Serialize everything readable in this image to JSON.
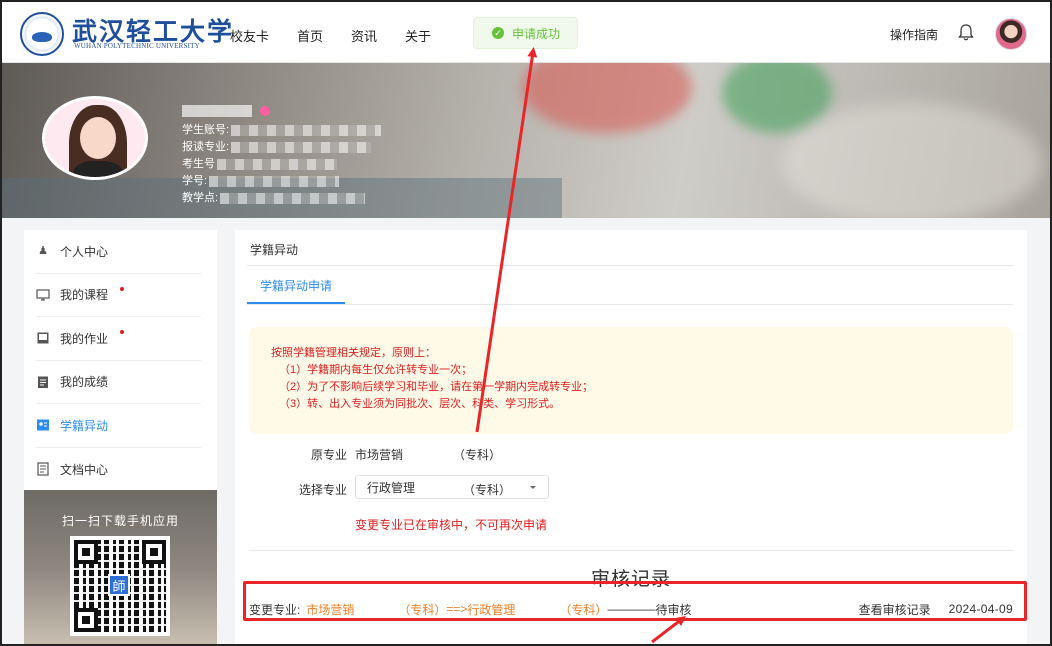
{
  "header": {
    "logo_cn": "武汉轻工大学",
    "logo_en": "WUHAN POLYTECHNIC UNIVERSITY",
    "nav": [
      "校友卡",
      "首页",
      "资讯",
      "关于"
    ],
    "toast": "申请成功",
    "guide": "操作指南"
  },
  "profile": {
    "fields": [
      {
        "label": "学生账号:"
      },
      {
        "label": "报读专业:"
      },
      {
        "label": "考生号"
      },
      {
        "label": "学号:"
      },
      {
        "label": "教学点:"
      }
    ]
  },
  "sidebar": {
    "items": [
      {
        "label": "个人中心",
        "icon": "person-icon",
        "active": false,
        "dot": false
      },
      {
        "label": "我的课程",
        "icon": "monitor-icon",
        "active": false,
        "dot": true
      },
      {
        "label": "我的作业",
        "icon": "book-icon",
        "active": false,
        "dot": true
      },
      {
        "label": "我的成绩",
        "icon": "clipboard-icon",
        "active": false,
        "dot": false
      },
      {
        "label": "学籍异动",
        "icon": "id-card-icon",
        "active": true,
        "dot": false
      },
      {
        "label": "文档中心",
        "icon": "document-icon",
        "active": false,
        "dot": false
      }
    ],
    "qr_title": "扫一扫下载手机应用",
    "qr_center": "師"
  },
  "main": {
    "title": "学籍异动",
    "tab": "学籍异动申请",
    "notice": [
      "按照学籍管理相关规定，原则上：",
      "（1）学籍期内每生仅允许转专业一次；",
      "（2）为了不影响后续学习和毕业，请在第一学期内完成转专业；",
      "（3）转、出入专业须为同批次、层次、科类、学习形式。"
    ],
    "orig_label": "原专业",
    "orig_value": "市场营销",
    "orig_type": "（专科）",
    "select_label": "选择专业",
    "select_value": "行政管理",
    "select_type": "（专科）",
    "warning": "变更专业已在审核中，不可再次申请",
    "review_title": "审核记录",
    "record": {
      "label": "变更专业:",
      "from": "市场营销",
      "from_type": "（专科）",
      "arrow": "==>",
      "to": "行政管理",
      "to_type": "（专科）",
      "dash": "————",
      "status": "待审核",
      "view_log": "查看审核记录",
      "date": "2024-04-09"
    }
  },
  "colors": {
    "accent": "#2d8cf0",
    "warning_red": "#e02020",
    "orange": "#f07f28",
    "success_green": "#67c23a",
    "annotation_red": "#e8262a"
  }
}
